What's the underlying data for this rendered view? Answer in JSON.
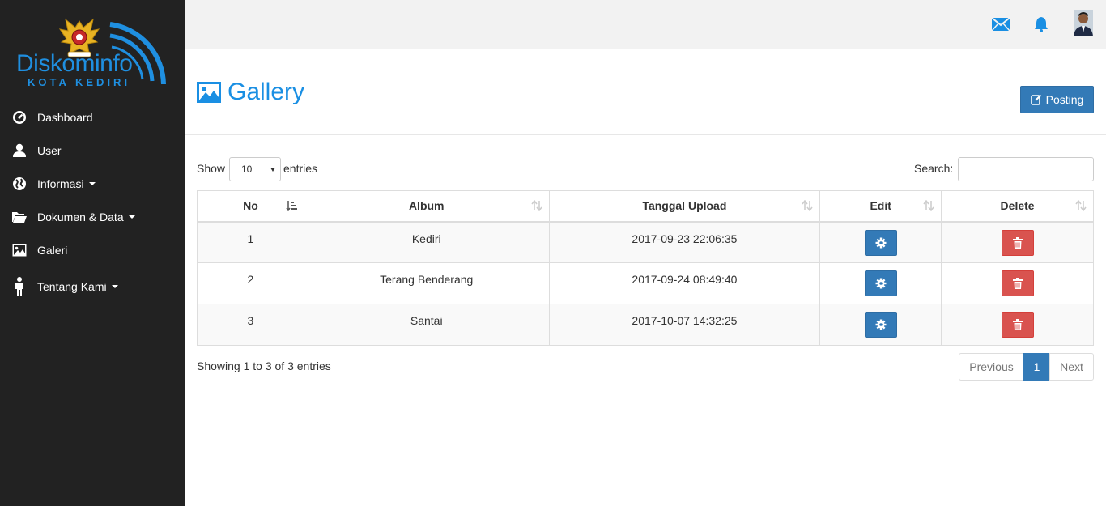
{
  "brand": {
    "logo_text": "Diskominfo",
    "logo_sub": "KOTA KEDIRI"
  },
  "sidebar": {
    "items": [
      {
        "label": "Dashboard",
        "icon": "dashboard-icon",
        "dropdown": false
      },
      {
        "label": "User",
        "icon": "user-icon",
        "dropdown": false
      },
      {
        "label": "Informasi",
        "icon": "globe-icon",
        "dropdown": true
      },
      {
        "label": "Dokumen & Data",
        "icon": "folder-open-icon",
        "dropdown": true
      },
      {
        "label": "Galeri",
        "icon": "picture-icon",
        "dropdown": false
      },
      {
        "label": "Tentang Kami",
        "icon": "person-icon",
        "dropdown": true
      }
    ]
  },
  "topbar": {
    "icons": [
      "envelope-icon",
      "bell-icon",
      "user-avatar"
    ]
  },
  "page": {
    "title": "Gallery",
    "title_icon": "picture-icon",
    "posting_label": "Posting"
  },
  "table_controls": {
    "show_label": "Show",
    "page_length": "10",
    "entries_label": "entries",
    "search_label": "Search:",
    "search_value": ""
  },
  "table": {
    "columns": [
      "No",
      "Album",
      "Tanggal Upload",
      "Edit",
      "Delete"
    ],
    "rows": [
      {
        "no": "1",
        "album": "Kediri",
        "tanggal": "2017-09-23 22:06:35"
      },
      {
        "no": "2",
        "album": "Terang Benderang",
        "tanggal": "2017-09-24 08:49:40"
      },
      {
        "no": "3",
        "album": "Santai",
        "tanggal": "2017-10-07 14:32:25"
      }
    ]
  },
  "footer": {
    "info": "Showing 1 to 3 of 3 entries",
    "previous": "Previous",
    "current_page": "1",
    "next": "Next"
  },
  "colors": {
    "accent": "#1a8fe3",
    "primary": "#337ab7",
    "danger": "#d9534f",
    "sidebar_bg": "#222222",
    "topbar_bg": "#f2f2f2"
  }
}
